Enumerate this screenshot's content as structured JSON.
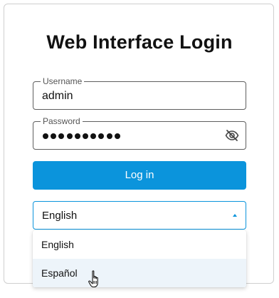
{
  "login": {
    "title": "Web Interface Login",
    "username_label": "Username",
    "username_value": "admin",
    "password_label": "Password",
    "password_masked": "••••••••••",
    "password_visibility_icon": "eye-slash-icon",
    "login_button_label": "Log in"
  },
  "language": {
    "selected": "English",
    "options": [
      "English",
      "Español"
    ],
    "hovered_option": "Español",
    "caret_icon": "caret-up-icon"
  },
  "colors": {
    "accent": "#0b94dc",
    "hover_bg": "#edf4fa",
    "text": "#111111",
    "border": "#5f5f5f"
  },
  "cursor": "hand-pointer-icon"
}
